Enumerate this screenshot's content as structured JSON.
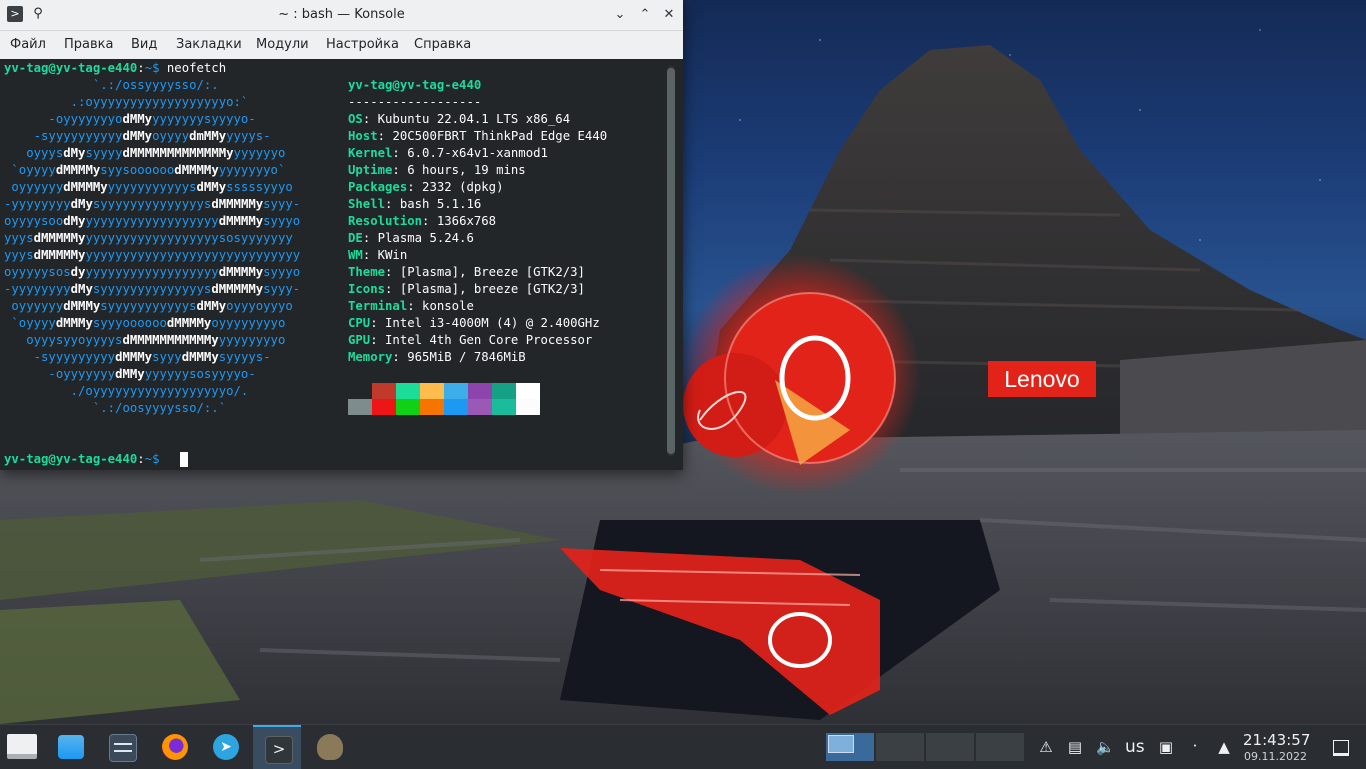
{
  "window": {
    "title": "~ : bash — Konsole"
  },
  "menu": [
    "Файл",
    "Правка",
    "Вид",
    "Закладки",
    "Модули",
    "Настройка",
    "Справка"
  ],
  "terminal": {
    "user_host": "yv-tag@yv-tag-e440",
    "sep": ":",
    "path_prompt": "~$",
    "command": "neofetch",
    "info_header": "yv-tag@yv-tag-e440",
    "info_rule": "------------------",
    "info": [
      {
        "key": "OS",
        "sep": ": ",
        "value": "Kubuntu 22.04.1 LTS x86_64"
      },
      {
        "key": "Host",
        "sep": ": ",
        "value": "20C500FBRT ThinkPad Edge E440"
      },
      {
        "key": "Kernel",
        "sep": ": ",
        "value": "6.0.7-x64v1-xanmod1"
      },
      {
        "key": "Uptime",
        "sep": ": ",
        "value": "6 hours, 19 mins"
      },
      {
        "key": "Packages",
        "sep": ": ",
        "value": "2332 (dpkg)"
      },
      {
        "key": "Shell",
        "sep": ": ",
        "value": "bash 5.1.16"
      },
      {
        "key": "Resolution",
        "sep": ": ",
        "value": "1366x768"
      },
      {
        "key": "DE",
        "sep": ": ",
        "value": "Plasma 5.24.6"
      },
      {
        "key": "WM",
        "sep": ": ",
        "value": "KWin"
      },
      {
        "key": "Theme",
        "sep": ": ",
        "value": "[Plasma], Breeze [GTK2/3]"
      },
      {
        "key": "Icons",
        "sep": ": ",
        "value": "[Plasma], breeze [GTK2/3]"
      },
      {
        "key": "Terminal",
        "sep": ": ",
        "value": "konsole"
      },
      {
        "key": "CPU",
        "sep": ": ",
        "value": "Intel i3-4000M (4) @ 2.400GHz"
      },
      {
        "key": "GPU",
        "sep": ": ",
        "value": "Intel 4th Gen Core Processor"
      },
      {
        "key": "Memory",
        "sep": ": ",
        "value": "965MiB / 7846MiB"
      }
    ],
    "ascii_art": [
      [
        [
          "b",
          "            `.:/ossyyyysso/:."
        ]
      ],
      [
        [
          "b",
          "         .:oyyyyyyyyyyyyyyyyyyo:`"
        ]
      ],
      [
        [
          "b",
          "      -oyyyyyyyo"
        ],
        [
          "w",
          "dMMy"
        ],
        [
          "b",
          "yyyyyyysyyyyo-"
        ]
      ],
      [
        [
          "b",
          "    -syyyyyyyyyy"
        ],
        [
          "w",
          "dMMy"
        ],
        [
          "b",
          "oyyyy"
        ],
        [
          "w",
          "dmMMy"
        ],
        [
          "b",
          "yyyys-"
        ]
      ],
      [
        [
          "b",
          "   oyyys"
        ],
        [
          "w",
          "dMy"
        ],
        [
          "b",
          "syyyy"
        ],
        [
          "w",
          "dMMMMMMMMMMMMMy"
        ],
        [
          "b",
          "yyyyyyo"
        ]
      ],
      [
        [
          "b",
          " `oyyyy"
        ],
        [
          "w",
          "dMMMMy"
        ],
        [
          "b",
          "syysoooooo"
        ],
        [
          "w",
          "dMMMMy"
        ],
        [
          "b",
          "yyyyyyyo`"
        ]
      ],
      [
        [
          "b",
          " oyyyyyy"
        ],
        [
          "w",
          "dMMMMy"
        ],
        [
          "b",
          "yyyyyyyyyyys"
        ],
        [
          "w",
          "dMMy"
        ],
        [
          "b",
          "sssssyyyo"
        ]
      ],
      [
        [
          "b",
          "-yyyyyyyy"
        ],
        [
          "w",
          "dMy"
        ],
        [
          "b",
          "syyyyyyyyyyyyyys"
        ],
        [
          "w",
          "dMMMMMy"
        ],
        [
          "b",
          "syyy-"
        ]
      ],
      [
        [
          "b",
          "oyyyysoo"
        ],
        [
          "w",
          "dMy"
        ],
        [
          "b",
          "yyyyyyyyyyyyyyyyyy"
        ],
        [
          "w",
          "dMMMMy"
        ],
        [
          "b",
          "syyyo"
        ]
      ],
      [
        [
          "b",
          "yyys"
        ],
        [
          "w",
          "dMMMMMy"
        ],
        [
          "b",
          "yyyyyyyyyyyyyyyyyysosyyyyyyy"
        ]
      ],
      [
        [
          "b",
          "yyys"
        ],
        [
          "w",
          "dMMMMMy"
        ],
        [
          "b",
          "yyyyyyyyyyyyyyyyyyyyyyyyyyyyy"
        ]
      ],
      [
        [
          "b",
          "oyyyyysos"
        ],
        [
          "w",
          "dy"
        ],
        [
          "b",
          "yyyyyyyyyyyyyyyyyy"
        ],
        [
          "w",
          "dMMMMy"
        ],
        [
          "b",
          "syyyo"
        ]
      ],
      [
        [
          "b",
          "-yyyyyyyy"
        ],
        [
          "w",
          "dMy"
        ],
        [
          "b",
          "syyyyyyyyyyyyyys"
        ],
        [
          "w",
          "dMMMMMy"
        ],
        [
          "b",
          "syyy-"
        ]
      ],
      [
        [
          "b",
          " oyyyyyy"
        ],
        [
          "w",
          "dMMMy"
        ],
        [
          "b",
          "syyyyyyyyyyys"
        ],
        [
          "w",
          "dMMy"
        ],
        [
          "b",
          "oyyyoyyyo"
        ]
      ],
      [
        [
          "b",
          " `oyyyy"
        ],
        [
          "w",
          "dMMMy"
        ],
        [
          "b",
          "syyyoooooo"
        ],
        [
          "w",
          "dMMMMy"
        ],
        [
          "b",
          "oyyyyyyyyo"
        ]
      ],
      [
        [
          "b",
          "   oyyysyyoyyyys"
        ],
        [
          "w",
          "dMMMMMMMMMMMy"
        ],
        [
          "b",
          "yyyyyyyyo"
        ]
      ],
      [
        [
          "b",
          "    -syyyyyyyyy"
        ],
        [
          "w",
          "dMMMy"
        ],
        [
          "b",
          "syyy"
        ],
        [
          "w",
          "dMMMy"
        ],
        [
          "b",
          "syyyys-"
        ]
      ],
      [
        [
          "b",
          "      -oyyyyyyy"
        ],
        [
          "w",
          "dMMy"
        ],
        [
          "b",
          "yyyyyysosyyyyo-"
        ]
      ],
      [
        [
          "b",
          "         ./oyyyyyyyyyyyyyyyyyyo/."
        ]
      ],
      [
        [
          "b",
          "            `.:/oosyyyysso/:.`"
        ]
      ]
    ],
    "palette": [
      "#7f8c8d",
      "#ed1515",
      "#11d116",
      "#f67400",
      "#1d99f3",
      "#9b59b6",
      "#1abc9c",
      "#fcfcfc"
    ],
    "palette_top": [
      "#232629",
      "#c0392b",
      "#1cdc9a",
      "#fdbc4b",
      "#3daee9",
      "#8e44ad",
      "#16a085",
      "#ffffff"
    ]
  },
  "wallpaper": {
    "brand": "Lenovo",
    "brand_color": "#e2231a"
  },
  "taskbar": {
    "tasks": [
      "app-launcher",
      "dolphin-file-manager",
      "system-settings",
      "firefox",
      "telegram",
      "konsole",
      "gimp"
    ],
    "keyboard_layout": "us",
    "time": "21:43:57",
    "date": "09.11.2022"
  }
}
